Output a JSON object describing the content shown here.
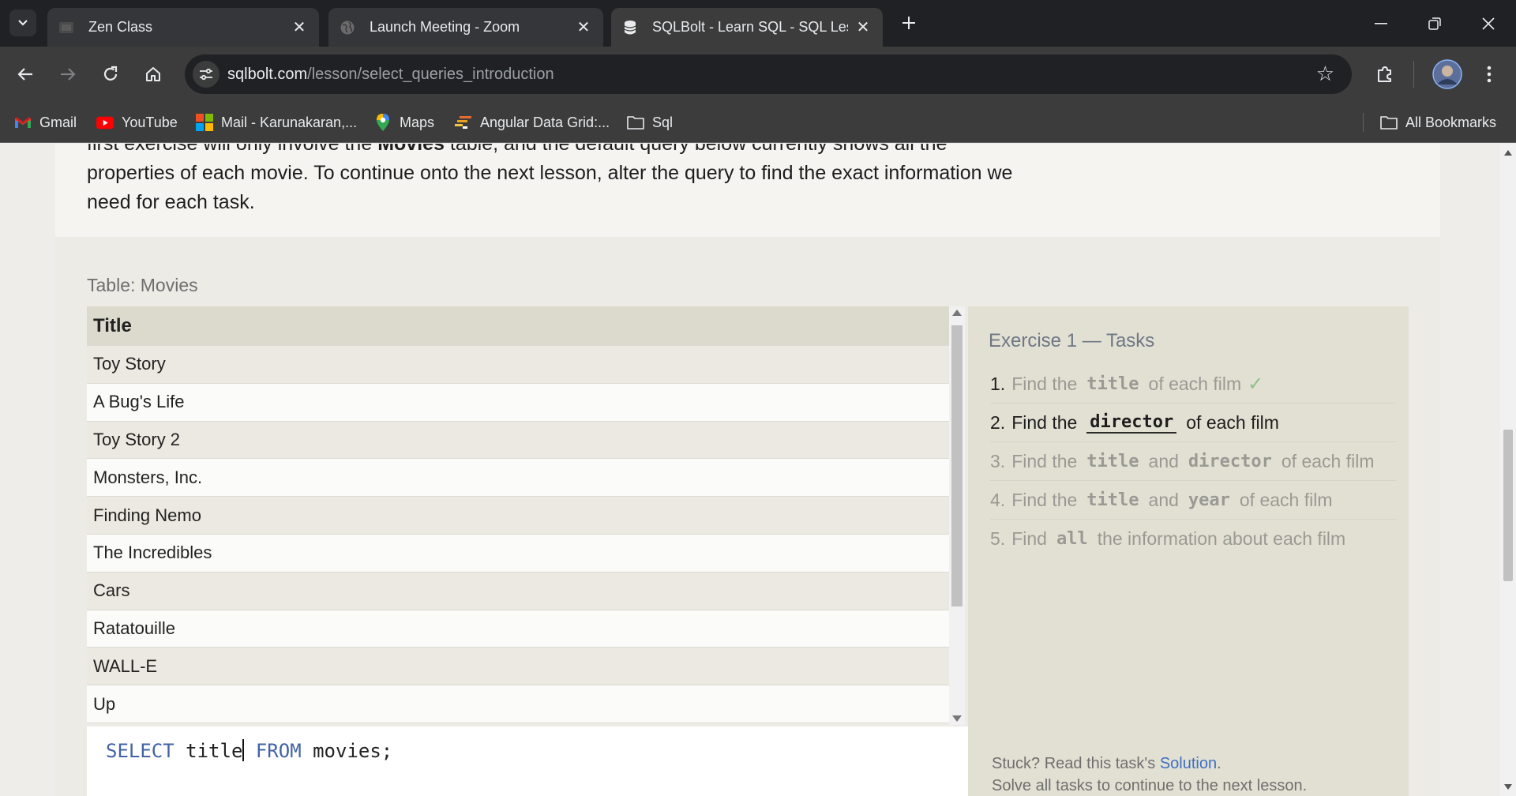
{
  "browser": {
    "tabs": [
      {
        "title": "Zen Class",
        "favicon": "zen-class-favicon"
      },
      {
        "title": "Launch Meeting - Zoom",
        "favicon": "globe-icon"
      },
      {
        "title": "SQLBolt - Learn SQL - SQL Less",
        "favicon": "database-icon"
      }
    ],
    "close_glyph": "✕",
    "url_host": "sqlbolt.com",
    "url_path": "/lesson/select_queries_introduction",
    "bookmarks": [
      {
        "label": "Gmail",
        "icon": "gmail-icon"
      },
      {
        "label": "YouTube",
        "icon": "youtube-icon"
      },
      {
        "label": "Mail - Karunakaran,...",
        "icon": "microsoft-icon"
      },
      {
        "label": "Maps",
        "icon": "maps-icon"
      },
      {
        "label": "Angular Data Grid:...",
        "icon": "ag-grid-icon"
      },
      {
        "label": "Sql",
        "icon": "folder-icon"
      }
    ],
    "all_bookmarks": "All Bookmarks"
  },
  "intro": {
    "line1_pre": "first exercise will only involve the ",
    "line1_bold": "Movies",
    "line1_post": " table, and the default query below currently shows all the",
    "line2": "properties of each movie. To continue onto the next lesson, alter the query to find the exact information we",
    "line3": "need for each task."
  },
  "table": {
    "label": "Table: Movies",
    "header": "Title",
    "rows": [
      "Toy Story",
      "A Bug's Life",
      "Toy Story 2",
      "Monsters, Inc.",
      "Finding Nemo",
      "The Incredibles",
      "Cars",
      "Ratatouille",
      "WALL-E",
      "Up"
    ]
  },
  "editor": {
    "kw_select": "SELECT",
    "col": " title",
    "kw_from": " FROM",
    "rest": " movies;"
  },
  "tasks": {
    "title": "Exercise 1 — Tasks",
    "items": [
      {
        "num": "1.",
        "pre": "Find the",
        "code1": "title",
        "mid": "",
        "code2": "",
        "post": "of each film",
        "check": "✓",
        "state": "done"
      },
      {
        "num": "2.",
        "pre": "Find the",
        "code1": "director",
        "mid": "",
        "code2": "",
        "post": "of each film",
        "check": "",
        "state": "current"
      },
      {
        "num": "3.",
        "pre": "Find the",
        "code1": "title",
        "mid": "and",
        "code2": "director",
        "post": "of each film",
        "check": "",
        "state": "todo"
      },
      {
        "num": "4.",
        "pre": "Find the",
        "code1": "title",
        "mid": "and",
        "code2": "year",
        "post": "of each film",
        "check": "",
        "state": "todo"
      },
      {
        "num": "5.",
        "pre": "Find",
        "code1": "all",
        "mid": "",
        "code2": "",
        "post": "the information about each film",
        "check": "",
        "state": "todo"
      }
    ],
    "stuck_text": "Stuck? Read this task's ",
    "solution_link": "Solution",
    "stuck_end": ".",
    "solve_all": "Solve all tasks to continue to the next lesson."
  }
}
